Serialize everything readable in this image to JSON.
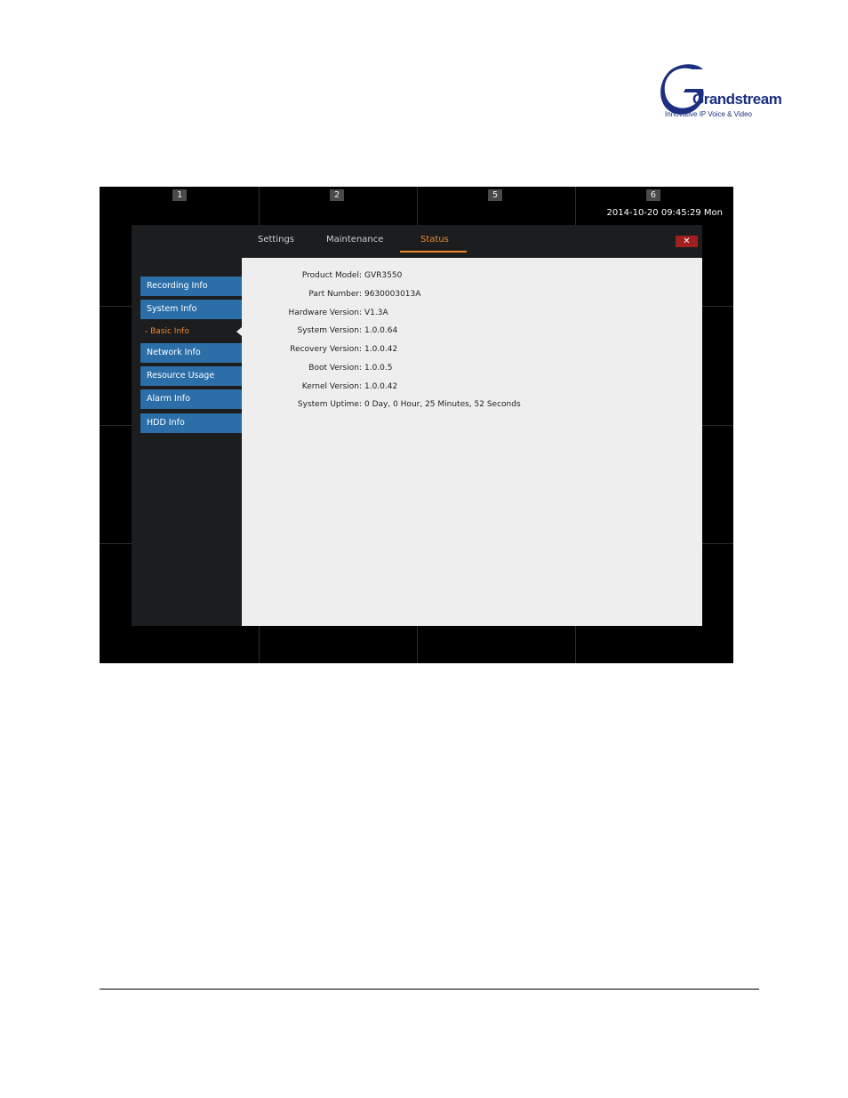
{
  "logo": {
    "word": "Grandstream",
    "tagline": "Innovative IP Voice & Video"
  },
  "screen": {
    "channels": [
      "1",
      "2",
      "5",
      "6"
    ],
    "clock": "2014-10-20 09:45:29 Mon"
  },
  "dialog": {
    "tabs": [
      {
        "label": "Settings",
        "active": false
      },
      {
        "label": "Maintenance",
        "active": false
      },
      {
        "label": "Status",
        "active": true
      }
    ],
    "close_icon": "close-icon",
    "close_glyph": "✕",
    "sidebar": {
      "items": [
        "Recording Info",
        "System Info",
        "Network Info",
        "Resource Usage",
        "Alarm Info",
        "HDD Info"
      ],
      "sub_item": "- Basic Info"
    },
    "info": [
      {
        "label": "Product Model:",
        "value": "GVR3550"
      },
      {
        "label": "Part Number:",
        "value": "9630003013A"
      },
      {
        "label": "Hardware Version:",
        "value": "V1.3A"
      },
      {
        "label": "System Version:",
        "value": "1.0.0.64"
      },
      {
        "label": "Recovery Version:",
        "value": "1.0.0.42"
      },
      {
        "label": "Boot Version:",
        "value": "1.0.0.5"
      },
      {
        "label": "Kernel Version:",
        "value": "1.0.0.42"
      },
      {
        "label": "System Uptime:",
        "value": "0 Day, 0 Hour, 25 Minutes, 52 Seconds"
      }
    ]
  },
  "colors": {
    "accent": "#f0872c",
    "sidebar_button": "#2b6ea8",
    "close_button": "#a01f1f",
    "logo_blue": "#1c2f80"
  }
}
